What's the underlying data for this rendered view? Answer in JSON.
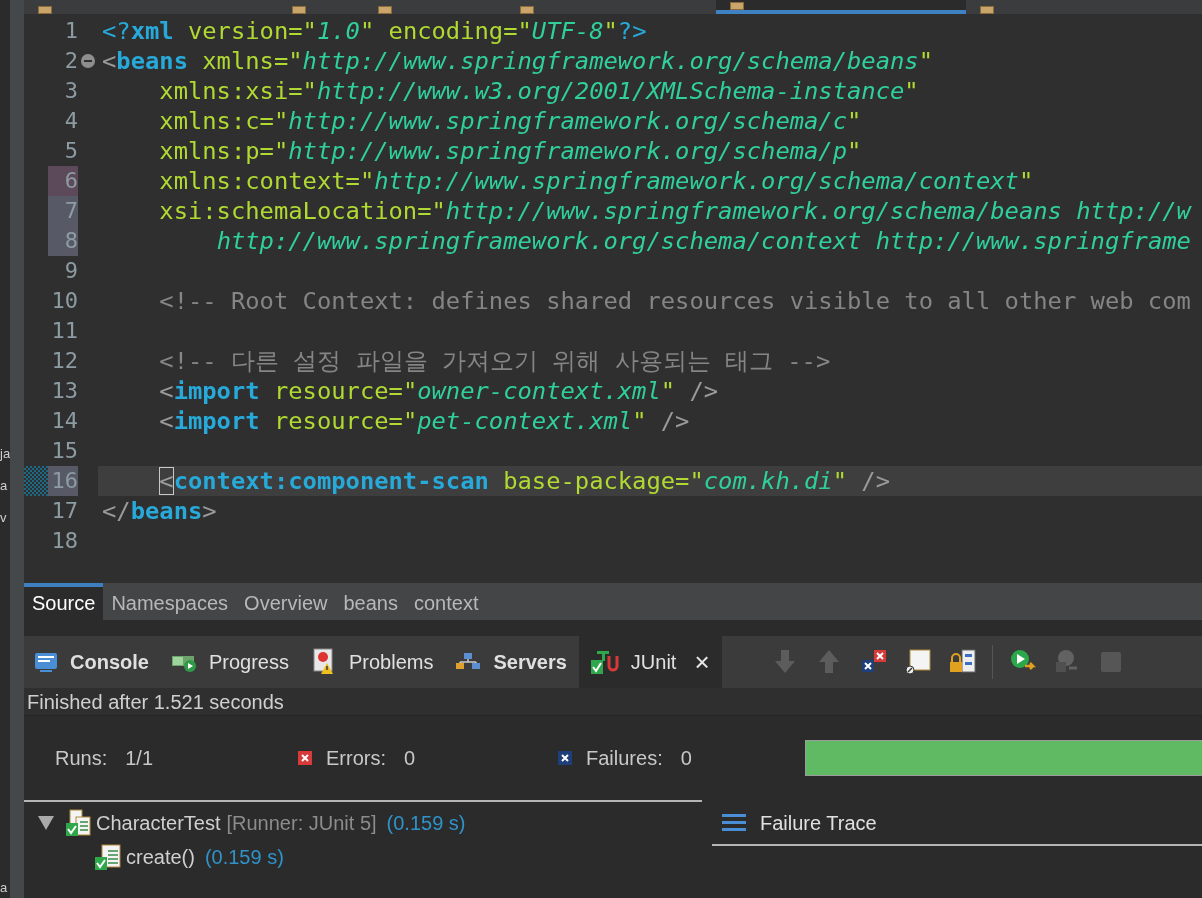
{
  "left_view": {
    "fragments": [
      "ja",
      "a",
      "v",
      "a"
    ]
  },
  "file_tabs": [
    {
      "selected": false
    },
    {
      "selected": false
    },
    {
      "selected": false
    },
    {
      "selected": false
    },
    {
      "selected": true
    },
    {
      "selected": false
    }
  ],
  "editor": {
    "lines": [
      {
        "number": "1",
        "current": false,
        "fold": false,
        "tokens": [
          {
            "kind": "pi",
            "text": "<?"
          },
          {
            "kind": "tag",
            "text": "xml"
          },
          {
            "kind": "attr",
            "text": " version=\""
          },
          {
            "kind": "string",
            "text": "1.0"
          },
          {
            "kind": "attr",
            "text": "\" encoding=\""
          },
          {
            "kind": "string",
            "text": "UTF-8"
          },
          {
            "kind": "attr",
            "text": "\""
          },
          {
            "kind": "pi",
            "text": "?>"
          }
        ]
      },
      {
        "number": "2",
        "current": false,
        "fold": true,
        "tokens": [
          {
            "kind": "punct",
            "text": "<"
          },
          {
            "kind": "tag",
            "text": "beans"
          },
          {
            "kind": "attr",
            "text": " xmlns=\""
          },
          {
            "kind": "string",
            "text": "http://www.springframework.org/schema/beans"
          },
          {
            "kind": "attr",
            "text": "\""
          }
        ]
      },
      {
        "number": "3",
        "current": false,
        "fold": false,
        "tokens": [
          {
            "kind": "attr",
            "text": "\txmlns:xsi=\""
          },
          {
            "kind": "string",
            "text": "http://www.w3.org/2001/XMLSchema-instance"
          },
          {
            "kind": "attr",
            "text": "\""
          }
        ]
      },
      {
        "number": "4",
        "current": false,
        "fold": false,
        "tokens": [
          {
            "kind": "attr",
            "text": "\txmlns:c=\""
          },
          {
            "kind": "string",
            "text": "http://www.springframework.org/schema/c"
          },
          {
            "kind": "attr",
            "text": "\""
          }
        ]
      },
      {
        "number": "5",
        "current": false,
        "fold": false,
        "tokens": [
          {
            "kind": "attr",
            "text": "\txmlns:p=\""
          },
          {
            "kind": "string",
            "text": "http://www.springframework.org/schema/p"
          },
          {
            "kind": "attr",
            "text": "\""
          }
        ]
      },
      {
        "number": "6",
        "current": false,
        "fold": false,
        "color": "#5c4a5a",
        "tokens": [
          {
            "kind": "attr",
            "text": "\txmlns:context=\""
          },
          {
            "kind": "string",
            "text": "http://www.springframework.org/schema/context"
          },
          {
            "kind": "attr",
            "text": "\""
          }
        ]
      },
      {
        "number": "7",
        "current": false,
        "fold": false,
        "color": "#575a66",
        "tokens": [
          {
            "kind": "attr",
            "text": "\txsi:schemaLocation=\""
          },
          {
            "kind": "string",
            "text": "http://www.springframework.org/schema/beans http://w"
          }
        ]
      },
      {
        "number": "8",
        "current": false,
        "fold": false,
        "color": "#575a66",
        "tokens": [
          {
            "kind": "string",
            "text": "\t\thttp://www.springframework.org/schema/context http://www.springframe"
          }
        ]
      },
      {
        "number": "9",
        "current": false,
        "fold": false
      },
      {
        "number": "10",
        "current": false,
        "fold": false,
        "tokens": [
          {
            "kind": "comment",
            "text": "\t<!-- Root Context: defines shared resources visible to all other web com"
          }
        ]
      },
      {
        "number": "11",
        "current": false,
        "fold": false
      },
      {
        "number": "12",
        "current": false,
        "fold": false,
        "tokens": [
          {
            "kind": "comment",
            "text": "\t<!-- 다른 설정 파일을 가져오기 위해 사용되는 태그 -->"
          }
        ]
      },
      {
        "number": "13",
        "current": false,
        "fold": false,
        "tokens": [
          {
            "kind": "punct",
            "text": "\t<"
          },
          {
            "kind": "tag",
            "text": "import"
          },
          {
            "kind": "attr",
            "text": " resource=\""
          },
          {
            "kind": "string",
            "text": "owner-context.xml"
          },
          {
            "kind": "attr",
            "text": "\""
          },
          {
            "kind": "punct",
            "text": " />"
          }
        ]
      },
      {
        "number": "14",
        "current": false,
        "fold": false,
        "tokens": [
          {
            "kind": "punct",
            "text": "\t<"
          },
          {
            "kind": "tag",
            "text": "import"
          },
          {
            "kind": "attr",
            "text": " resource=\""
          },
          {
            "kind": "string",
            "text": "pet-context.xml"
          },
          {
            "kind": "attr",
            "text": "\""
          },
          {
            "kind": "punct",
            "text": " />"
          }
        ]
      },
      {
        "number": "15",
        "current": false,
        "fold": false
      },
      {
        "number": "16",
        "current": true,
        "fold": false,
        "color": "#575a66",
        "annotation": true,
        "tokens": [
          {
            "kind": "bracket-match",
            "text": "\t<"
          },
          {
            "kind": "tag",
            "text": "context:component-scan"
          },
          {
            "kind": "attr",
            "text": " base-package=\""
          },
          {
            "kind": "string",
            "text": "com.kh.di"
          },
          {
            "kind": "attr",
            "text": "\""
          },
          {
            "kind": "punct",
            "text": " />"
          }
        ]
      },
      {
        "number": "17",
        "current": false,
        "fold": false,
        "tokens": [
          {
            "kind": "punct",
            "text": "</"
          },
          {
            "kind": "tag",
            "text": "beans"
          },
          {
            "kind": "punct",
            "text": ">"
          }
        ]
      },
      {
        "number": "18",
        "current": false,
        "fold": false
      }
    ]
  },
  "editor_tabs": [
    {
      "label": "Source",
      "selected": true
    },
    {
      "label": "Namespaces",
      "selected": false
    },
    {
      "label": "Overview",
      "selected": false
    },
    {
      "label": "beans",
      "selected": false
    },
    {
      "label": "context",
      "selected": false
    }
  ],
  "view_tabs": [
    {
      "label": "Console",
      "kind": "console",
      "selected": false,
      "changed": true
    },
    {
      "label": "Progress",
      "kind": "progress",
      "selected": false,
      "changed": false
    },
    {
      "label": "Problems",
      "kind": "problems",
      "selected": false,
      "changed": false
    },
    {
      "label": "Servers",
      "kind": "servers",
      "selected": false,
      "changed": true
    },
    {
      "label": "JUnit",
      "kind": "junit",
      "selected": true,
      "changed": false,
      "close": "×"
    }
  ],
  "toolbar": [
    [
      {
        "kind": "down",
        "disabled": true
      },
      {
        "kind": "up",
        "disabled": true
      },
      {
        "kind": "cross",
        "disabled": false
      },
      {
        "kind": "page",
        "disabled": false
      },
      {
        "kind": "lock",
        "disabled": false
      }
    ],
    [
      {
        "kind": "play",
        "disabled": false
      },
      {
        "kind": "replay",
        "disabled": true
      },
      {
        "kind": "stop",
        "disabled": true
      }
    ]
  ],
  "junit": {
    "status": "Finished after 1.521 seconds",
    "counters": [
      {
        "kind": "runs",
        "label": "Runs:",
        "value": "1/1"
      },
      {
        "kind": "errors",
        "label": "Errors:",
        "value": "0"
      },
      {
        "kind": "failures",
        "label": "Failures:",
        "value": "0"
      }
    ],
    "progress": {
      "level": 1,
      "failed": false
    },
    "tree": [
      {
        "kind": "class",
        "name": "CharacterTest",
        "runner": "[Runner: JUnit 5]",
        "time": "(0.159 s)",
        "expanded": true,
        "children": [
          {
            "kind": "method",
            "name": "create()",
            "time": "(0.159 s)"
          }
        ]
      }
    ],
    "failure_trace": {
      "title": "Failure Trace"
    }
  }
}
